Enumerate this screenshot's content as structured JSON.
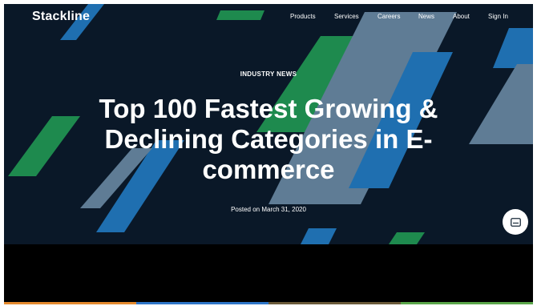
{
  "header": {
    "logo": "Stackline",
    "nav": [
      "Products",
      "Services",
      "Careers",
      "News",
      "About",
      "Sign In"
    ]
  },
  "hero": {
    "kicker": "INDUSTRY NEWS",
    "title": "Top 100 Fastest Growing & Declining Categories in E-commerce",
    "posted": "Posted on March 31, 2020"
  },
  "widgets": {
    "chat_icon": "message-icon"
  },
  "colors": {
    "background": "#0a1828",
    "accent_blue": "#1f6fb0",
    "accent_green": "#1e8a4e",
    "accent_slate": "#5f7c95",
    "bar_orange": "#e58a2e",
    "bar_blue": "#2e76c8",
    "bar_brown": "#6b5a3a",
    "bar_green": "#5aa64a"
  }
}
